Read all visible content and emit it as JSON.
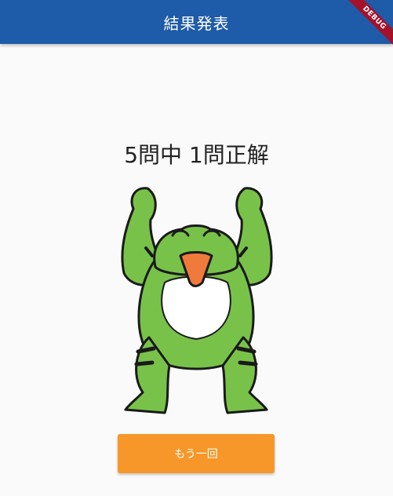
{
  "appbar": {
    "title": "結果発表",
    "color": "#1e5ba8"
  },
  "debug_banner": {
    "label": "DEBUG"
  },
  "result": {
    "text": "5問中 1問正解"
  },
  "image": {
    "icon": "cheering-frog-illustration"
  },
  "retry_button": {
    "label": "もう一回",
    "color": "#f7972a"
  }
}
